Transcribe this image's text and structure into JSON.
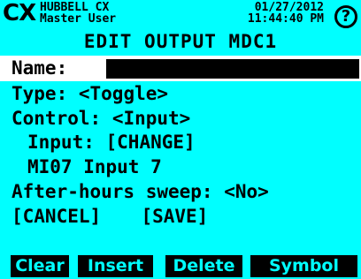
{
  "header": {
    "logo": "CX",
    "company": "HUBBELL CX",
    "user": "Master User",
    "date": "01/27/2012",
    "time": "11:44:40 PM",
    "help_glyph": "?"
  },
  "title": "EDIT OUTPUT MDC1",
  "form": {
    "name_label": "Name:",
    "name_value": "",
    "type_label": "Type:",
    "type_value": "<Toggle>",
    "control_label": "Control:",
    "control_value": "<Input>",
    "input_label": "Input:",
    "input_change": "[CHANGE]",
    "input_selected": "MI07 Input 7",
    "afterhours_label": "After-hours sweep:",
    "afterhours_value": "<No>",
    "cancel": "[CANCEL]",
    "save": "[SAVE]"
  },
  "softkeys": [
    "Clear",
    "Insert",
    "Delete",
    "Symbol"
  ],
  "colors": {
    "background": "#00ffff",
    "softkey_bg": "#000000",
    "highlight_row": "#ffffff"
  },
  "icons": {
    "help": "help-icon"
  }
}
